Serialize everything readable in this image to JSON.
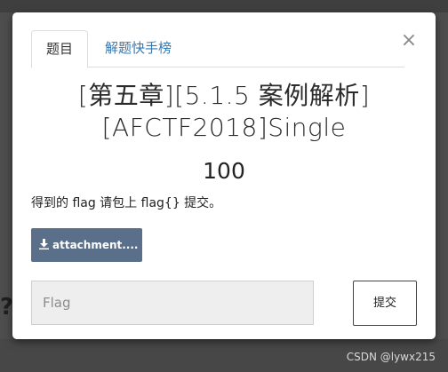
{
  "tabs": [
    {
      "label": "题目"
    },
    {
      "label": "解题快手榜"
    }
  ],
  "close_glyph": "×",
  "challenge": {
    "title_line1": "[第五章][5.1.5 案例解析]",
    "title_line2": "[AFCTF2018]Single",
    "points": "100",
    "description": "得到的 flag 请包上 flag{} 提交。",
    "attachment_label": "attachment....",
    "attachment_icon": "download-icon"
  },
  "form": {
    "flag_placeholder": "Flag",
    "flag_value": "",
    "submit_label": "提交"
  },
  "watermark": "CSDN @lywx215",
  "colors": {
    "accent_link": "#337ab7",
    "attachment_button": "#5a6f8a"
  }
}
